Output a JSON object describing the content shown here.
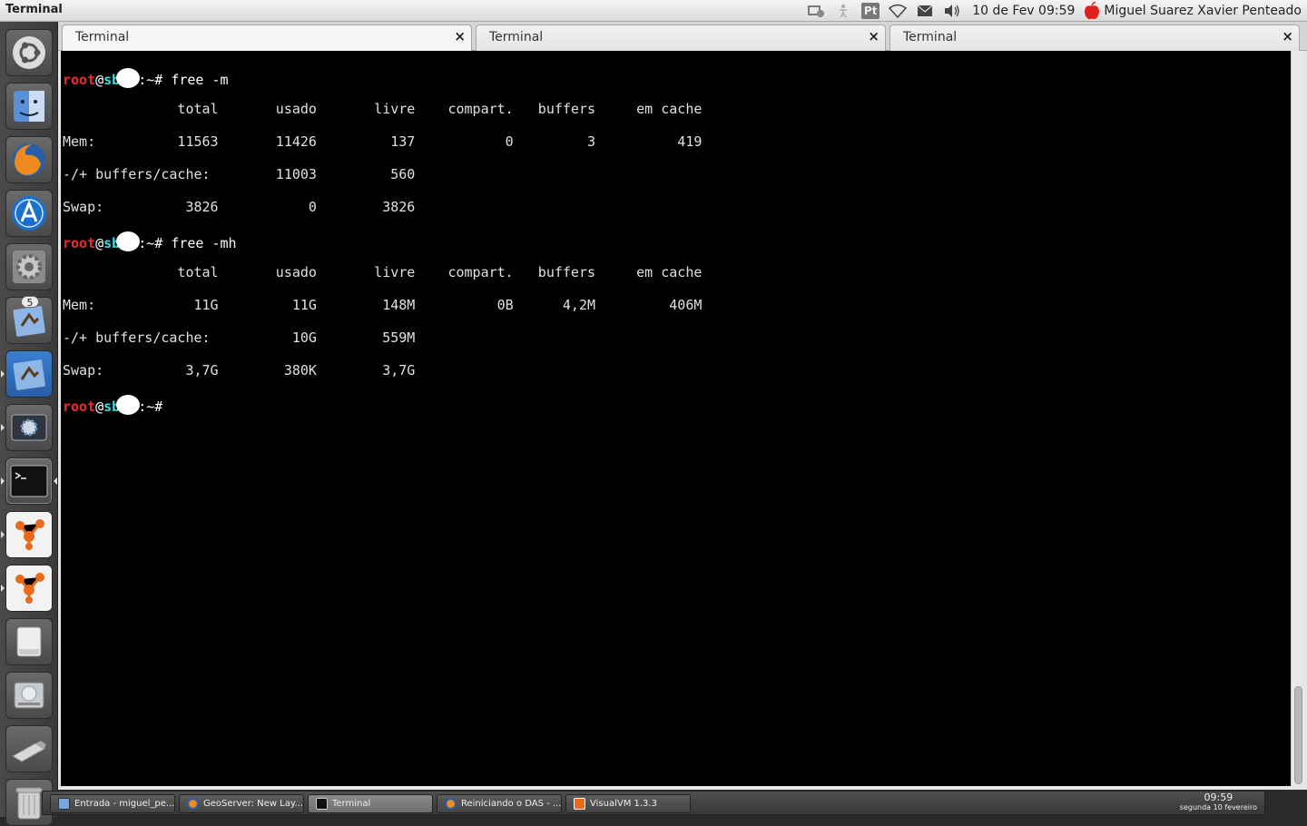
{
  "panel": {
    "app_title": "Terminal",
    "input_lang": "Pt",
    "clock": "10 de Fev  09:59",
    "user": "Miguel Suarez Xavier Penteado"
  },
  "launcher": {
    "items": [
      {
        "name": "ubuntu-home-icon"
      },
      {
        "name": "files-finder-icon"
      },
      {
        "name": "firefox-icon"
      },
      {
        "name": "app-store-icon"
      },
      {
        "name": "system-settings-icon"
      },
      {
        "name": "mail-icon",
        "badge": "5"
      },
      {
        "name": "mail-icon-2"
      },
      {
        "name": "system-config-icon"
      },
      {
        "name": "terminal-icon"
      },
      {
        "name": "visualvm-icon"
      },
      {
        "name": "visualvm-icon-2"
      },
      {
        "name": "drive-icon"
      },
      {
        "name": "hard-disk-icon"
      },
      {
        "name": "usb-drive-icon"
      },
      {
        "name": "trash-icon"
      }
    ]
  },
  "tabs": [
    {
      "label": "Terminal"
    },
    {
      "label": "Terminal"
    },
    {
      "label": "Terminal"
    }
  ],
  "terminal": {
    "user": "root",
    "at": "@",
    "host": "sb",
    "path": ":~# ",
    "cmd1": "free -m",
    "cmd2": "free -mh",
    "header": "              total       usado       livre    compart.   buffers     em cache",
    "out1": [
      "Mem:          11563       11426         137           0         3          419",
      "-/+ buffers/cache:        11003         560",
      "Swap:          3826           0        3826"
    ],
    "out2": [
      "Mem:            11G         11G        148M          0B      4,2M         406M",
      "-/+ buffers/cache:          10G        559M",
      "Swap:          3,7G        380K        3,7G"
    ]
  },
  "taskbar": {
    "tasks": [
      {
        "label": "Entrada - miguel_pe..."
      },
      {
        "label": "GeoServer: New Lay..."
      },
      {
        "label": "Terminal"
      },
      {
        "label": "Reiniciando o DAS - ..."
      },
      {
        "label": "VisualVM 1.3.3"
      }
    ],
    "time": "09:59",
    "date": "segunda 10 fevereiro"
  }
}
